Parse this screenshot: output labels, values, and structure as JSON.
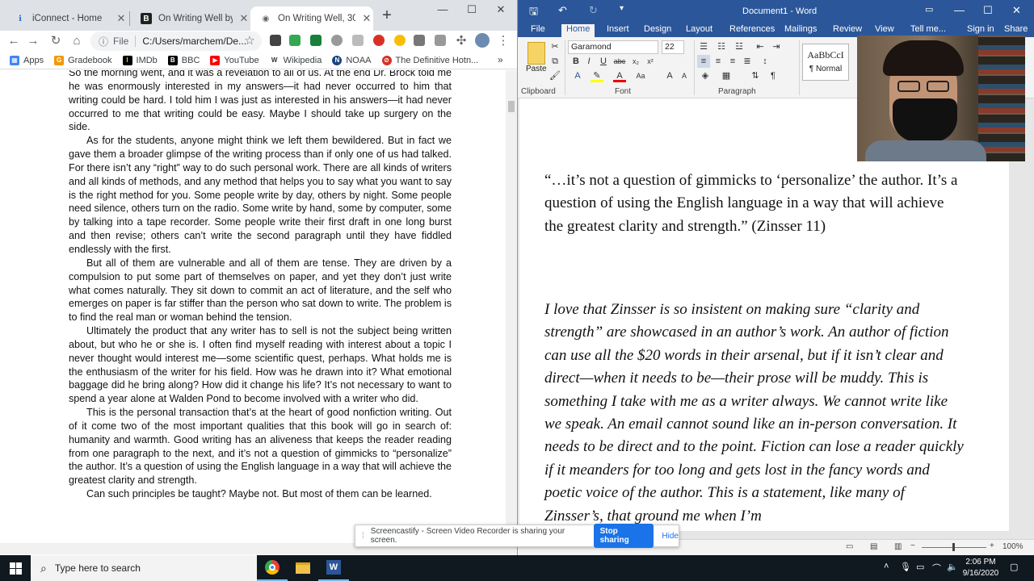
{
  "chrome": {
    "tabs": [
      {
        "title": "iConnect - Home",
        "favicon": "iconnect-icon",
        "active": false
      },
      {
        "title": "On Writing Well by Will",
        "favicon": "book-icon",
        "active": false
      },
      {
        "title": "On Writing Well, 30th A",
        "favicon": "globe-icon",
        "active": true
      }
    ],
    "address": {
      "scheme": "File",
      "url": "C:/Users/marchem/De..."
    },
    "bookmarks": [
      {
        "label": "Apps",
        "icon": "apps-grid-icon",
        "color": "#4285f4"
      },
      {
        "label": "Gradebook",
        "icon": "gradebook-icon",
        "color": "#f29900"
      },
      {
        "label": "IMDb",
        "icon": "imdb-icon",
        "color": "#000000"
      },
      {
        "label": "BBC",
        "icon": "bbc-icon",
        "color": "#000000"
      },
      {
        "label": "YouTube",
        "icon": "youtube-icon",
        "color": "#ff0000"
      },
      {
        "label": "Wikipedia",
        "icon": "wikipedia-icon",
        "color": "#333333"
      },
      {
        "label": "NOAA",
        "icon": "noaa-icon",
        "color": "#1a4480"
      },
      {
        "label": "The Definitive Hotn...",
        "icon": "hotness-icon",
        "color": "#d93025"
      }
    ],
    "pdf_paragraphs": [
      {
        "text": "So the morning went, and it was a revelation to all of us. At the end Dr. Brock told me he was enormously interested in my answers—it had never occurred to him that writing could be hard. I told him I was just as interested in his answers—it had never occurred to me that writing could be easy. Maybe I should take up surgery on the side.",
        "indent": false
      },
      {
        "text": "As for the students, anyone might think we left them bewildered. But in fact we gave them a broader glimpse of the writing process than if only one of us had talked. For there isn’t any “right” way to do such personal work. There are all kinds of writers and all kinds of methods, and any method that helps you to say what you want to say is the right method for you. Some people write by day, others by night. Some people need silence, others turn on the radio. Some write by hand, some by computer, some by talking into a tape recorder. Some people write their first draft in one long burst and then revise; others can’t write the second paragraph until they have fiddled endlessly with the first.",
        "indent": true
      },
      {
        "text": "But all of them are vulnerable and all of them are tense. They are driven by a compulsion to put some part of themselves on paper, and yet they don’t just write what comes naturally. They sit down to commit an act of literature, and the self who emerges on paper is far stiffer than the person who sat down to write. The problem is to find the real man or woman behind the tension.",
        "indent": true
      },
      {
        "text": "Ultimately the product that any writer has to sell is not the subject being written about, but who he or she is. I often find myself reading with interest about a topic I never thought would interest me—some scientific quest, perhaps. What holds me is the enthusiasm of the writer for his field. How was he drawn into it? What emotional baggage did he bring along? How did it change his life? It’s not necessary to want to spend a year alone at Walden Pond to become involved with a writer who did.",
        "indent": true
      },
      {
        "text": "This is the personal transaction that’s at the heart of good nonfiction writing. Out of it come two of the most important qualities that this book will go in search of: humanity and warmth. Good writing has an aliveness that keeps the reader reading from one paragraph to the next, and it’s not a question of gimmicks to “personalize” the author. It’s a question of using the English language in a way that will achieve the greatest clarity and strength.",
        "indent": true
      },
      {
        "text": "Can such principles be taught? Maybe not. But most of them can be learned.",
        "indent": true
      }
    ]
  },
  "word": {
    "title": "Document1 - Word",
    "tabs": [
      "File",
      "Home",
      "Insert",
      "Design",
      "Layout",
      "References",
      "Mailings",
      "Review",
      "View",
      "Tell me...",
      "Sign in",
      "Share"
    ],
    "active_tab": "Home",
    "font_name": "Garamond",
    "font_size": "22",
    "style_preview": "AaBbCcI",
    "style_name": "¶ Normal",
    "group_labels": {
      "clipboard": "Clipboard",
      "font": "Font",
      "paragraph": "Paragraph"
    },
    "paste_label": "Paste",
    "quote": "“…it’s not a question of gimmicks to ‘personalize’ the author. It’s a question of using the English language in a way that will achieve the greatest clarity and strength.” (Zinsser 11)",
    "body": "I love that Zinsser is so insistent on making sure “clarity and strength” are showcased in an author’s work. An author of fiction can use all the $20 words in their arsenal, but if it isn’t clear and direct—when it needs to be—their prose will be muddy. This is something I take with me as a writer always. We cannot write like we speak. An email cannot sound like an in-person conversation. It needs to be direct and to the point. Fiction can lose a reader quickly if it meanders for too long and gets lost in the fancy words and poetic voice of the author. This is a statement, like many of Zinsser’s, that ground me when I’m",
    "zoom": "100%",
    "accent": "#2b579a"
  },
  "share_banner": {
    "message": "Screencastify - Screen Video Recorder is sharing your screen.",
    "stop_label": "Stop sharing",
    "hide_label": "Hide"
  },
  "taskbar": {
    "search_placeholder": "Type here to search",
    "time": "2:06 PM",
    "date": "9/16/2020"
  }
}
